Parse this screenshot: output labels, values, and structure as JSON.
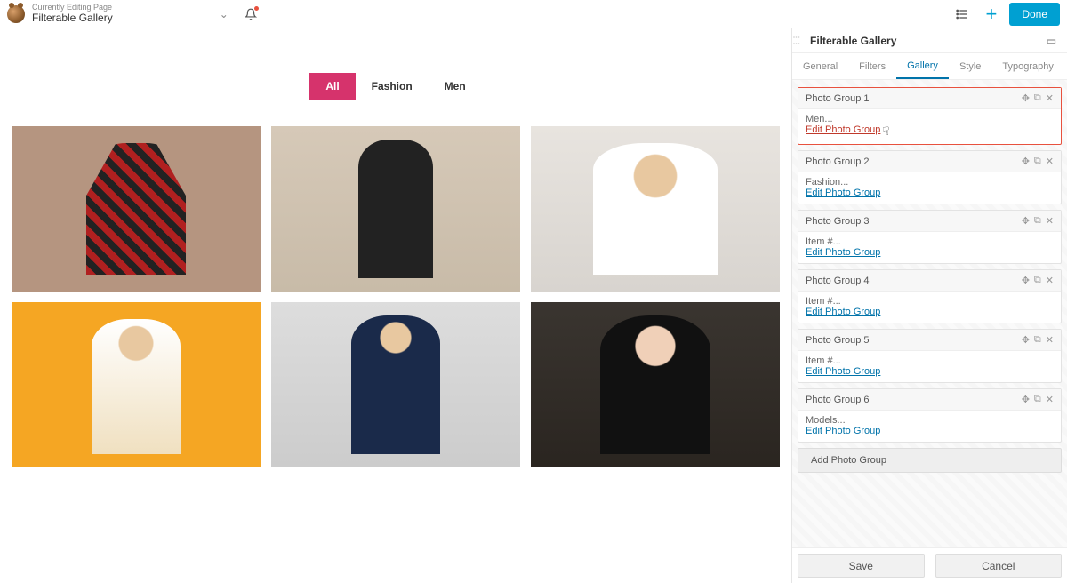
{
  "header": {
    "context_label": "Currently Editing Page",
    "page_title": "Filterable Gallery",
    "done_label": "Done"
  },
  "filters": {
    "items": [
      {
        "label": "All",
        "active": true
      },
      {
        "label": "Fashion",
        "active": false
      },
      {
        "label": "Men",
        "active": false
      }
    ]
  },
  "panel": {
    "title": "Filterable Gallery",
    "tabs": {
      "items": [
        {
          "label": "General"
        },
        {
          "label": "Filters"
        },
        {
          "label": "Gallery"
        },
        {
          "label": "Style"
        },
        {
          "label": "Typography"
        }
      ],
      "active_index": 2
    },
    "groups": [
      {
        "title": "Photo Group 1",
        "meta": "Men...",
        "edit": "Edit Photo Group",
        "selected": true
      },
      {
        "title": "Photo Group 2",
        "meta": "Fashion...",
        "edit": "Edit Photo Group",
        "selected": false
      },
      {
        "title": "Photo Group 3",
        "meta": "Item #...",
        "edit": "Edit Photo Group",
        "selected": false
      },
      {
        "title": "Photo Group 4",
        "meta": "Item #...",
        "edit": "Edit Photo Group",
        "selected": false
      },
      {
        "title": "Photo Group 5",
        "meta": "Item #...",
        "edit": "Edit Photo Group",
        "selected": false
      },
      {
        "title": "Photo Group 6",
        "meta": "Models...",
        "edit": "Edit Photo Group",
        "selected": false
      }
    ],
    "add_label": "Add Photo Group",
    "footer": {
      "save": "Save",
      "cancel": "Cancel"
    }
  },
  "colors": {
    "accent": "#00a0d2",
    "filter_active": "#d6336c",
    "link": "#0073aa",
    "selected_border": "#e8513e"
  }
}
